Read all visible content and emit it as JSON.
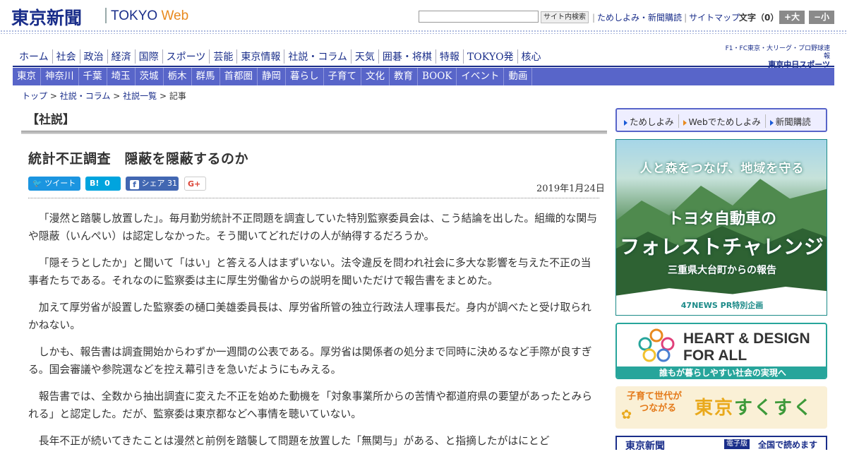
{
  "header": {
    "logo_jp": "東京新聞",
    "logo_tokyo": "TOKYO",
    "logo_web": "Web",
    "search_button": "サイト内検索",
    "links": [
      "ためしよみ・新聞購読",
      "サイトマップ"
    ],
    "text_size_label": "文字（0）",
    "text_size_up": "+大",
    "text_size_down": "−小"
  },
  "main_nav": [
    "ホーム",
    "社会",
    "政治",
    "経済",
    "国際",
    "スポーツ",
    "芸能",
    "東京情報",
    "社説・コラム",
    "天気",
    "囲碁・将棋",
    "特報",
    "TOKYO発",
    "核心"
  ],
  "promo": {
    "line1": "F1・FC東京・大リーグ・プロ野球速報",
    "logo": "東京中日スポーツ"
  },
  "sub_nav": [
    "東京",
    "神奈川",
    "千葉",
    "埼玉",
    "茨城",
    "栃木",
    "群馬",
    "首都圏",
    "静岡",
    "暮らし",
    "子育て",
    "文化",
    "教育",
    "BOOK",
    "イベント",
    "動画"
  ],
  "breadcrumb": {
    "items": [
      "トップ",
      "社説・コラム",
      "社説一覧",
      "記事"
    ],
    "separator": ">"
  },
  "section_title": "【社説】",
  "article": {
    "title": "統計不正調査　隠蔽を隠蔽するのか",
    "date": "2019年1月24日",
    "share": {
      "tweet": "ツイート",
      "hatena_label": "B!",
      "hatena_count": "0",
      "facebook_label": "シェア",
      "facebook_count": "31",
      "gplus": "G+"
    },
    "paragraphs": [
      "「漫然と踏襲し放置した」。毎月勤労統計不正問題を調査していた特別監察委員会は、こう結論を出した。組織的な関与や隠蔽（いんぺい）は認定しなかった。そう聞いてどれだけの人が納得するだろうか。",
      "「隠そうとしたか」と聞いて「はい」と答える人はまずいない。法令違反を問われ社会に多大な影響を与えた不正の当事者たちである。それなのに監察委は主に厚生労働省からの説明を聞いただけで報告書をまとめた。",
      "加えて厚労省が設置した監察委の樋口美雄委員長は、厚労省所管の独立行政法人理事長だ。身内が調べたと受け取られかねない。",
      "しかも、報告書は調査開始からわずか一週間の公表である。厚労省は関係者の処分まで同時に決めるなど手際が良すぎる。国会審議や参院選などを控え幕引きを急いだようにもみえる。",
      "報告書では、全数から抽出調査に変えた不正を始めた動機を「対象事業所からの苦情や都道府県の要望があったとみられる」と認定した。だが、監察委は東京都などへ事情を聴いていない。",
      "長年不正が続いてきたことは漫然と前例を踏襲して問題を放置した「無関与」がある、と指摘したがはにとど"
    ]
  },
  "sidebar": {
    "buttons": [
      "ためしよみ",
      "Webでためしよみ",
      "新聞購読"
    ],
    "ad_forest": {
      "arc_text": "人と森をつなげ、地域を守る",
      "company": "トヨタ自動車の",
      "title": "フォレストチャレンジ",
      "subtitle": "三重県大台町からの報告",
      "credit": "47NEWS PR特別企画"
    },
    "ad_heart": {
      "line1": "HEART & DESIGN",
      "line2": "FOR ALL",
      "caption": "誰もが暮らしやすい社会の実現へ"
    },
    "ad_kids": {
      "tagline1": "子育て世代が",
      "tagline2": "つながる",
      "brand_a": "東京",
      "brand_b": "すくすく"
    },
    "ad_tokyo": {
      "logo": "東京新聞",
      "tag": "電子版",
      "text": "全国で読めます"
    }
  },
  "colors": {
    "brand_navy": "#1a2e8a",
    "sub_nav_blue": "#5865c9",
    "web_orange": "#e8891e",
    "twitter": "#1b95e0",
    "hatena": "#00a4de",
    "facebook": "#4267b2",
    "teal": "#27a59b"
  }
}
